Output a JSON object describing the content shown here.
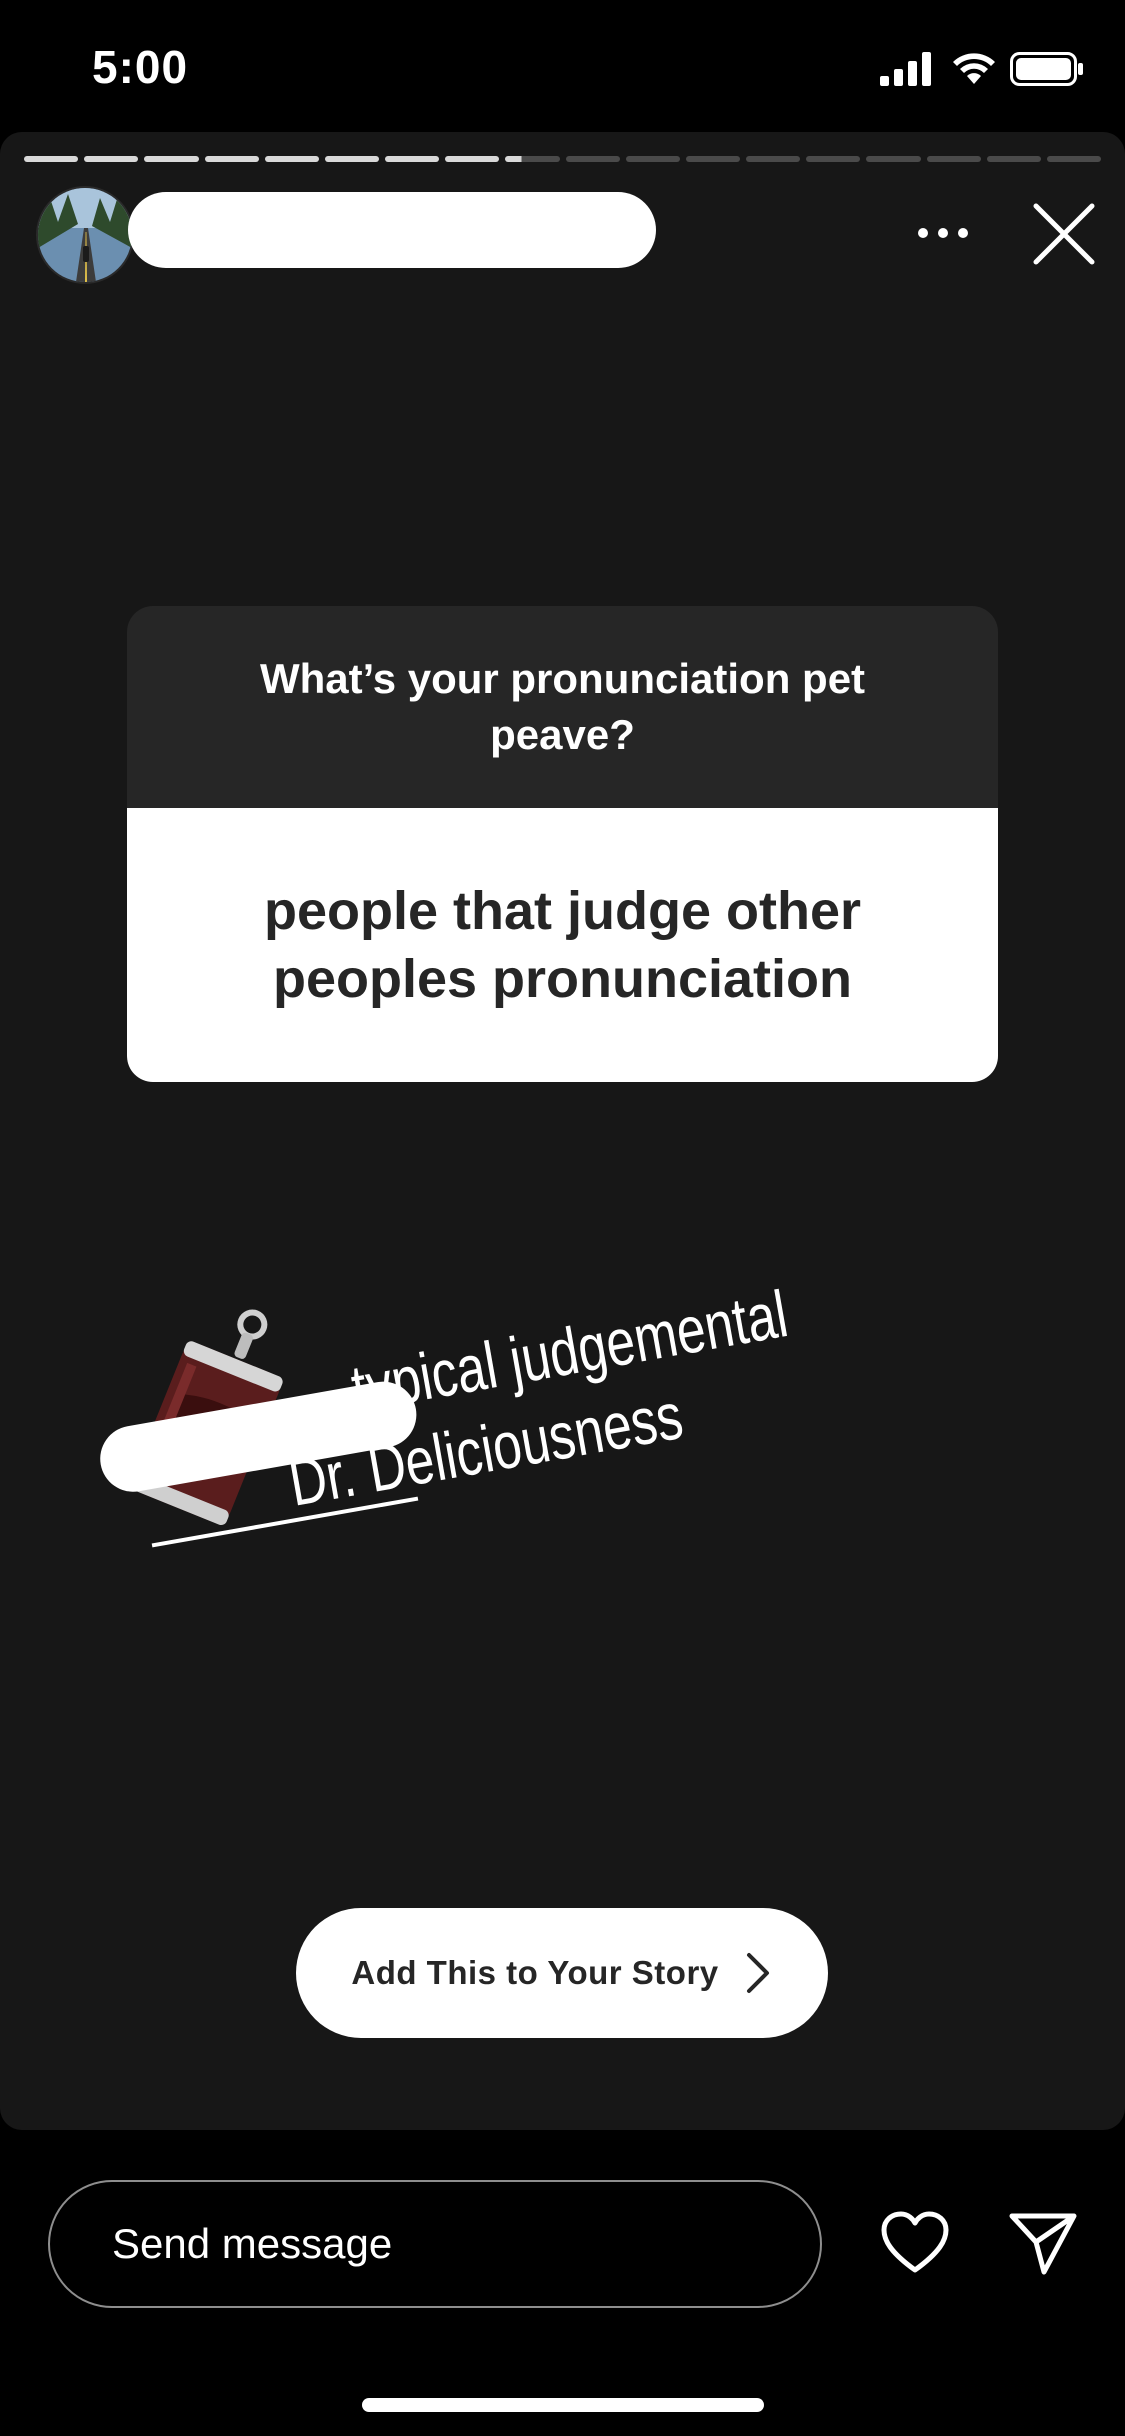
{
  "status_bar": {
    "time": "5:00"
  },
  "story": {
    "progress": {
      "segments": 18,
      "completed": 8,
      "current_fraction": 0.3
    },
    "question_sticker": {
      "question": "What’s your pronunciation pet peave?",
      "answer": "people that judge other peoples pronunciation"
    },
    "overlay_text": {
      "line1": "typical judgemental",
      "line2": "Dr. Deliciousness"
    },
    "cta": {
      "label": "Add This to Your Story"
    }
  },
  "bottom_bar": {
    "message_placeholder": "Send message"
  },
  "colors": {
    "story_bg": "#171717",
    "question_header": "#262626",
    "text_dark": "#262626"
  }
}
